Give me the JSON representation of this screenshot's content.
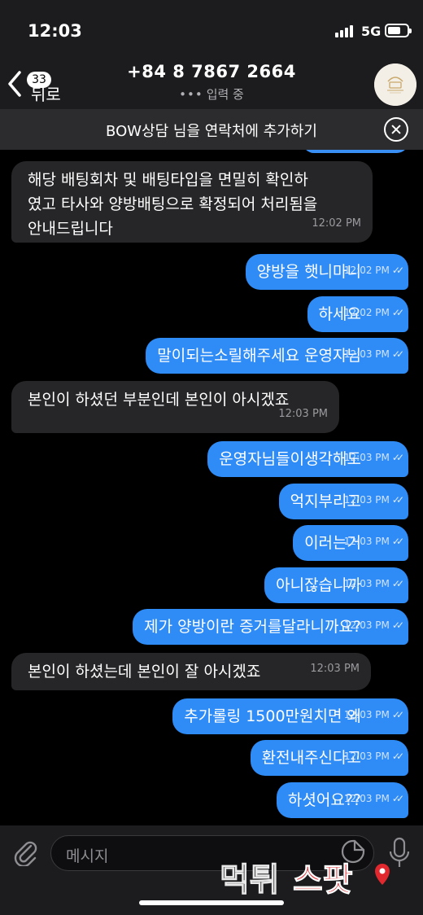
{
  "status_bar": {
    "time": "12:03",
    "network": "5G"
  },
  "header": {
    "back_label": "뒤로",
    "unread_count": "33",
    "phone_number": "+84 8 7867 2664",
    "typing_status": "입력 중"
  },
  "add_contact": {
    "text": "BOW상담 님을 연락처에 추가하기"
  },
  "messages": [
    {
      "direction": "in",
      "text": "해당 배팅회차 및 배팅타입을 면밀히 확인하\n였고 타사와 양방배팅으로 확정되어 처리됨을\n안내드립니다",
      "time": "12:02 PM"
    },
    {
      "direction": "out",
      "text": "양방을 햇니마니",
      "time": "12:02 PM"
    },
    {
      "direction": "out",
      "text": "하세요",
      "time": "12:02 PM"
    },
    {
      "direction": "out",
      "text": "말이되는소릴해주세요 운영자님",
      "time": "12:03 PM"
    },
    {
      "direction": "in",
      "text": "본인이 하셨던 부분인데 본인이 아시겠죠",
      "time": "12:03 PM"
    },
    {
      "direction": "out",
      "text": "운영자님들이생각해도",
      "time": "12:03 PM"
    },
    {
      "direction": "out",
      "text": "억지부리고",
      "time": "12:03 PM"
    },
    {
      "direction": "out",
      "text": "이러는거",
      "time": "12:03 PM"
    },
    {
      "direction": "out",
      "text": "아니잖습니까",
      "time": "12:03 PM"
    },
    {
      "direction": "out",
      "text": "제가 양방이란 증거를달라니까요?",
      "time": "12:03 PM"
    },
    {
      "direction": "in",
      "text": "본인이 하셨는데 본인이 잘 아시겠죠",
      "time": "12:03 PM"
    },
    {
      "direction": "out",
      "text": "추가롤링 1500만원치면 왜",
      "time": "12:03 PM"
    },
    {
      "direction": "out",
      "text": "환전내주신다고",
      "time": "12:03 PM"
    },
    {
      "direction": "out",
      "text": "하셧어요??",
      "time": "12:03 PM"
    }
  ],
  "input_bar": {
    "placeholder": "메시지"
  },
  "watermark": {
    "text": "먹튀스팟"
  },
  "colors": {
    "outgoing_bubble": "#2f8cf6",
    "incoming_bubble": "#262628",
    "background": "#000000",
    "watermark_red": "#e0282e"
  }
}
